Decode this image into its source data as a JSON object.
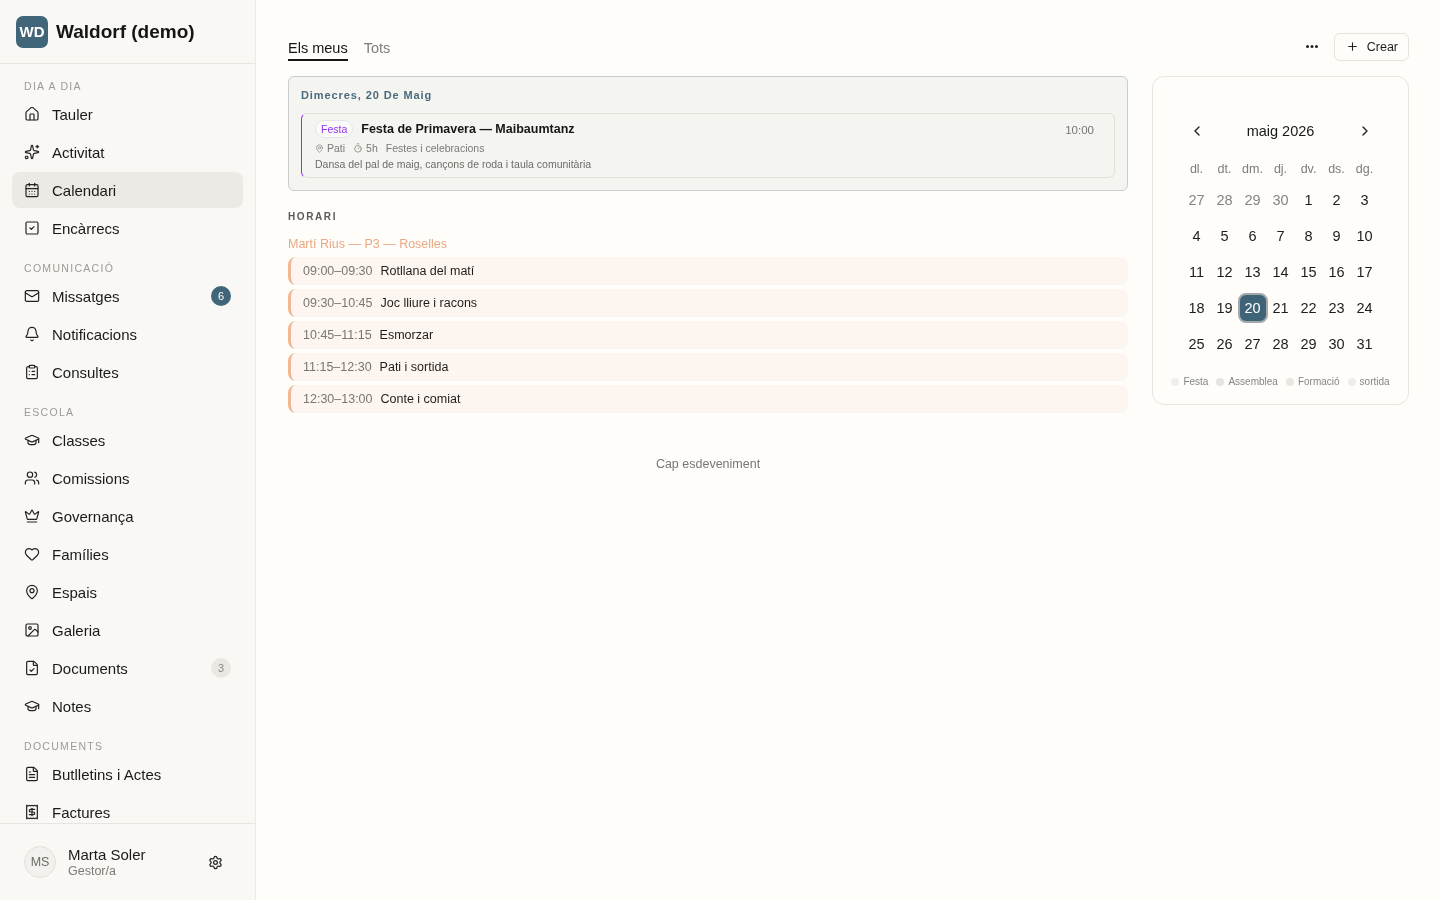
{
  "sidebar": {
    "logo": "WD",
    "title": "Waldorf (demo)",
    "sections": [
      {
        "label": "DIA A DIA",
        "items": [
          {
            "label": "Tauler",
            "selected": false
          },
          {
            "label": "Activitat",
            "selected": false
          },
          {
            "label": "Calendari",
            "selected": true
          },
          {
            "label": "Encàrrecs",
            "selected": false
          }
        ]
      },
      {
        "label": "COMUNICACIÓ",
        "items": [
          {
            "label": "Missatges",
            "selected": false,
            "badge": {
              "text": "6",
              "kind": "strong"
            }
          },
          {
            "label": "Notificacions",
            "selected": false
          },
          {
            "label": "Consultes",
            "selected": false
          }
        ]
      },
      {
        "label": "ESCOLA",
        "items": [
          {
            "label": "Classes",
            "selected": false
          },
          {
            "label": "Comissions",
            "selected": false
          },
          {
            "label": "Governança",
            "selected": false
          },
          {
            "label": "Famílies",
            "selected": false
          },
          {
            "label": "Espais",
            "selected": false
          },
          {
            "label": "Galeria",
            "selected": false
          },
          {
            "label": "Documents",
            "selected": false,
            "badge": {
              "text": "3",
              "kind": "muted"
            }
          },
          {
            "label": "Notes",
            "selected": false
          }
        ]
      },
      {
        "label": "DOCUMENTS",
        "items": [
          {
            "label": "Butlletins i Actes",
            "selected": false
          },
          {
            "label": "Factures",
            "selected": false
          }
        ]
      }
    ],
    "user": {
      "initials": "MS",
      "name": "Marta Soler",
      "role": "Gestor/a"
    }
  },
  "tabs": [
    {
      "label": "Els meus",
      "selected": true
    },
    {
      "label": "Tots",
      "selected": false
    }
  ],
  "actions": {
    "create": "Crear"
  },
  "day": {
    "heading": "Dimecres, 20 De Maig",
    "events": [
      {
        "tag": "Festa",
        "color": "#9333ea",
        "title": "Festa de Primavera — Maibaumtanz",
        "time": "10:00",
        "place": "Pati",
        "duration": "5h",
        "category": "Festes i celebracions",
        "description": "Dansa del pal de maig, cançons de roda i taula comunitària"
      }
    ]
  },
  "schedule": {
    "label": "HORARI",
    "groups": [
      {
        "name": "Martí Rius — P3 — Roselles",
        "slots": [
          {
            "time": "09:00–09:30",
            "title": "Rotllana del matí"
          },
          {
            "time": "09:30–10:45",
            "title": "Joc lliure i racons"
          },
          {
            "time": "10:45–11:15",
            "title": "Esmorzar"
          },
          {
            "time": "11:15–12:30",
            "title": "Pati i sortida"
          },
          {
            "time": "12:30–13:00",
            "title": "Conte i comiat"
          }
        ]
      }
    ]
  },
  "empty_state": "Cap esdeveniment",
  "calendar": {
    "month": "maig 2026",
    "weekdays": [
      "dl.",
      "dt.",
      "dm.",
      "dj.",
      "dv.",
      "ds.",
      "dg."
    ],
    "weeks": [
      [
        {
          "day": "27",
          "muted": true,
          "selected": false
        },
        {
          "day": "28",
          "muted": true,
          "selected": false
        },
        {
          "day": "29",
          "muted": true,
          "selected": false
        },
        {
          "day": "30",
          "muted": true,
          "selected": false
        },
        {
          "day": "1",
          "muted": false,
          "selected": false
        },
        {
          "day": "2",
          "muted": false,
          "selected": false
        },
        {
          "day": "3",
          "muted": false,
          "selected": false
        }
      ],
      [
        {
          "day": "4",
          "muted": false,
          "selected": false
        },
        {
          "day": "5",
          "muted": false,
          "selected": false
        },
        {
          "day": "6",
          "muted": false,
          "selected": false
        },
        {
          "day": "7",
          "muted": false,
          "selected": false
        },
        {
          "day": "8",
          "muted": false,
          "selected": false
        },
        {
          "day": "9",
          "muted": false,
          "selected": false
        },
        {
          "day": "10",
          "muted": false,
          "selected": false
        }
      ],
      [
        {
          "day": "11",
          "muted": false,
          "selected": false
        },
        {
          "day": "12",
          "muted": false,
          "selected": false
        },
        {
          "day": "13",
          "muted": false,
          "selected": false
        },
        {
          "day": "14",
          "muted": false,
          "selected": false
        },
        {
          "day": "15",
          "muted": false,
          "selected": false
        },
        {
          "day": "16",
          "muted": false,
          "selected": false
        },
        {
          "day": "17",
          "muted": false,
          "selected": false
        }
      ],
      [
        {
          "day": "18",
          "muted": false,
          "selected": false
        },
        {
          "day": "19",
          "muted": false,
          "selected": false
        },
        {
          "day": "20",
          "muted": false,
          "selected": true
        },
        {
          "day": "21",
          "muted": false,
          "selected": false
        },
        {
          "day": "22",
          "muted": false,
          "selected": false
        },
        {
          "day": "23",
          "muted": false,
          "selected": false
        },
        {
          "day": "24",
          "muted": false,
          "selected": false
        }
      ],
      [
        {
          "day": "25",
          "muted": false,
          "selected": false
        },
        {
          "day": "26",
          "muted": false,
          "selected": false
        },
        {
          "day": "27",
          "muted": false,
          "selected": false
        },
        {
          "day": "28",
          "muted": false,
          "selected": false
        },
        {
          "day": "29",
          "muted": false,
          "selected": false
        },
        {
          "day": "30",
          "muted": false,
          "selected": false
        },
        {
          "day": "31",
          "muted": false,
          "selected": false
        }
      ]
    ],
    "legend": [
      {
        "label": "Festa",
        "color": "#efeeea"
      },
      {
        "label": "Assemblea",
        "color": "#e4e3df"
      },
      {
        "label": "Formació",
        "color": "#e9e7e0"
      },
      {
        "label": "sortida",
        "color": "#eeedea"
      }
    ]
  }
}
